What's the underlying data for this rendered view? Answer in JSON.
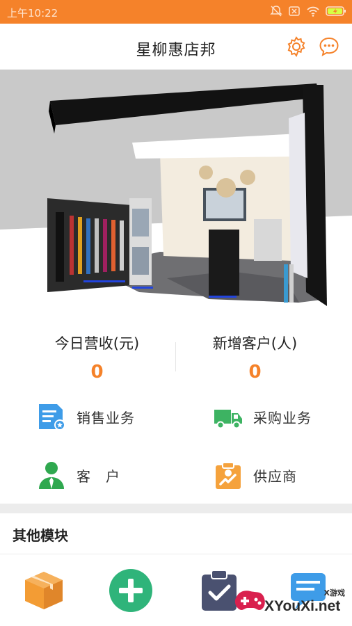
{
  "status_bar": {
    "time": "上午10:22",
    "icons": [
      "mute-icon",
      "sim-icon",
      "wifi-icon",
      "battery-icon"
    ]
  },
  "header": {
    "title": "星柳惠店邦",
    "icons": [
      "gear-icon",
      "chat-icon"
    ]
  },
  "hero": {
    "image": "store-showroom-banner"
  },
  "stats": {
    "revenue": {
      "label": "今日营收(元)",
      "value": "0"
    },
    "new_customers": {
      "label": "新增客户(人)",
      "value": "0"
    }
  },
  "menu": {
    "sales": {
      "label": "销售业务",
      "icon": "sales-document-icon"
    },
    "purchase": {
      "label": "采购业务",
      "icon": "truck-icon"
    },
    "customer": {
      "label": "客　户",
      "icon": "customer-icon"
    },
    "supplier": {
      "label": "供应商",
      "icon": "supplier-icon"
    }
  },
  "other_modules": {
    "title": "其他模块",
    "items": [
      {
        "label": "",
        "icon": "box-icon"
      },
      {
        "label": "",
        "icon": "plus-icon"
      },
      {
        "label": "",
        "icon": "clipboard-check-icon"
      },
      {
        "label": "",
        "icon": "message-icon"
      }
    ]
  },
  "watermark": {
    "text": "XYouXi.net",
    "subtext": "X游戏"
  },
  "colors": {
    "accent": "#f5822a",
    "green": "#2fb47a",
    "blue": "#3e9ce8",
    "dark": "#4a5170"
  }
}
